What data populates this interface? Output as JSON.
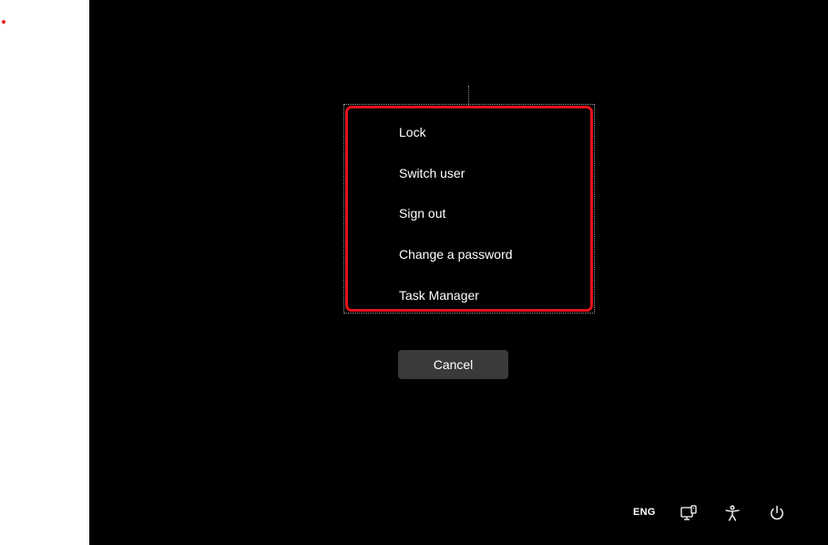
{
  "menu": {
    "items": [
      {
        "label": "Lock"
      },
      {
        "label": "Switch user"
      },
      {
        "label": "Sign out"
      },
      {
        "label": "Change a password"
      },
      {
        "label": "Task Manager"
      }
    ]
  },
  "cancel": {
    "label": "Cancel"
  },
  "taskbar": {
    "language": "ENG",
    "icons": [
      "network-icon",
      "accessibility-icon",
      "power-icon"
    ]
  },
  "colors": {
    "background": "#000000",
    "highlight": "#e3121c",
    "button": "#3a3a3a",
    "text": "#ffffff"
  }
}
